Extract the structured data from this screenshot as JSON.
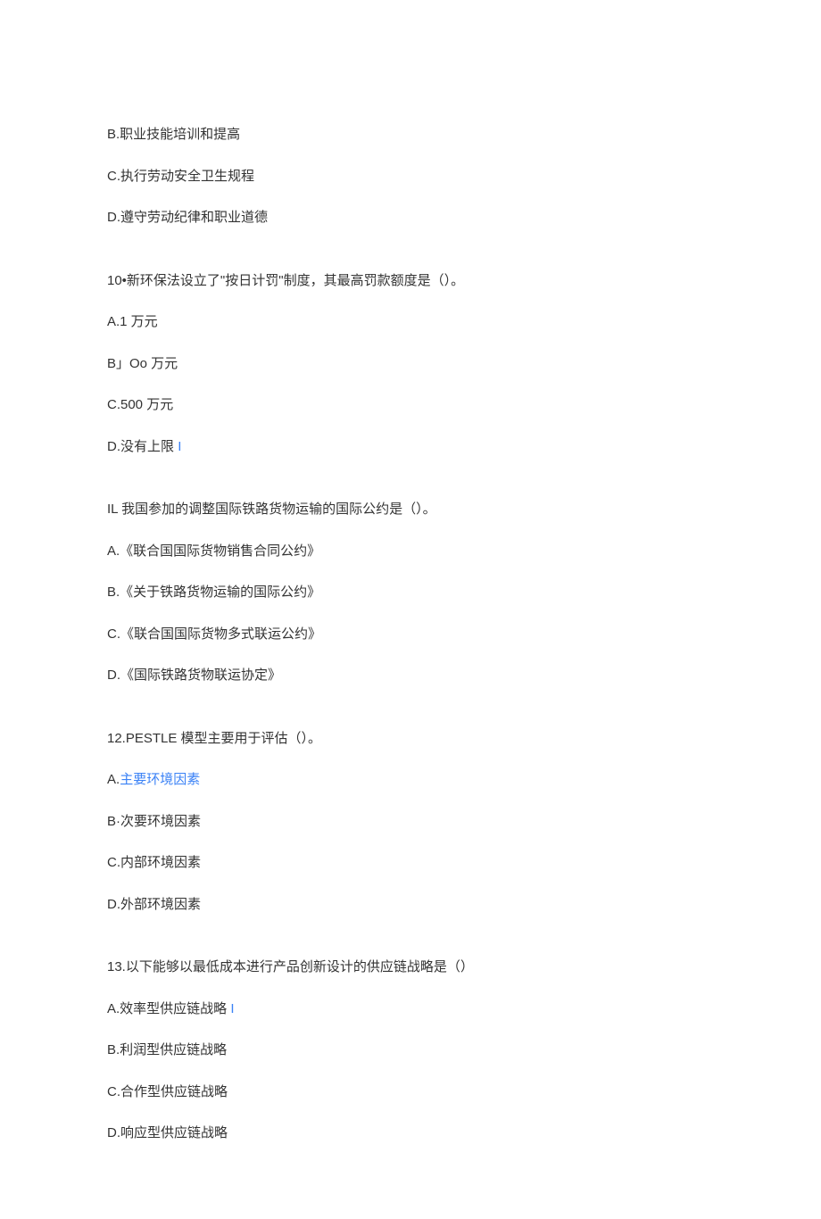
{
  "q9": {
    "optB": "B.职业技能培训和提高",
    "optC": "C.执行劳动安全卫生规程",
    "optD": "D.遵守劳动纪律和职业道德"
  },
  "q10": {
    "stem_prefix": "10•新环保法设立了\"按日计罚\"制度，其最高罚款额度是（）。",
    "optA": "A.1 万元",
    "optB": "B」Oo 万元",
    "optC": "C.500 万元",
    "optD_prefix": "D.没有上限",
    "optD_mark": "I"
  },
  "q11": {
    "stem": "IL 我国参加的调整国际铁路货物运输的国际公约是（）。",
    "optA": "A.《联合国国际货物销售合同公约》",
    "optB": "B.《关于铁路货物运输的国际公约》",
    "optC": "C.《联合国国际货物多式联运公约》",
    "optD": "D.《国际铁路货物联运协定》"
  },
  "q12": {
    "stem": "12.PESTLE 模型主要用于评估（）。",
    "optA_prefix": "A.",
    "optA_body": "主要环境因素",
    "optB": "B·次要环境因素",
    "optC": "C.内部环境因素",
    "optD": "D.外部环境因素"
  },
  "q13": {
    "stem": "13.以下能够以最低成本进行产品创新设计的供应链战略是（）",
    "optA_prefix": "A.效率型供应链战略",
    "optA_mark": "I",
    "optB": "B.利润型供应链战略",
    "optC": "C.合作型供应链战略",
    "optD": "D.响应型供应链战略"
  }
}
